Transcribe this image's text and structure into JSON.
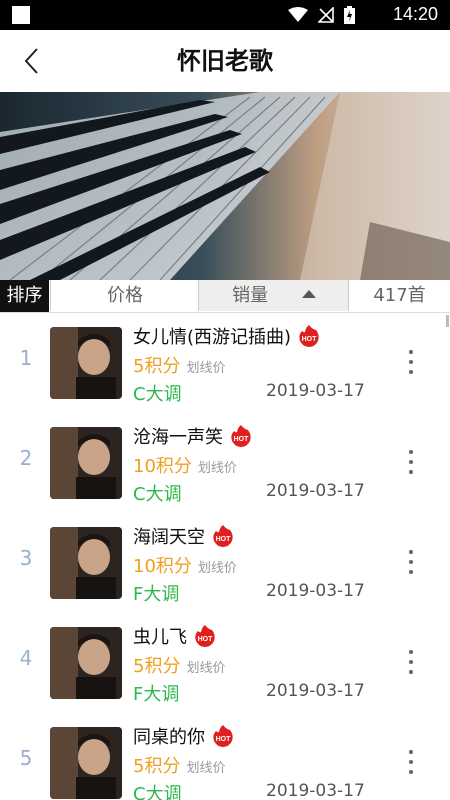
{
  "status_bar": {
    "time": "14:20"
  },
  "header": {
    "title": "怀旧老歌"
  },
  "sort_bar": {
    "label": "排序",
    "options": [
      {
        "label": "价格"
      },
      {
        "label": "销量"
      },
      {
        "label": "417首"
      }
    ]
  },
  "songs": [
    {
      "index": "1",
      "title": "女儿情(西游记插曲)",
      "price": "5积分",
      "strike_label": "划线价",
      "key": "C大调",
      "date": "2019-03-17",
      "hot": "HOT"
    },
    {
      "index": "2",
      "title": "沧海一声笑",
      "price": "10积分",
      "strike_label": "划线价",
      "key": "C大调",
      "date": "2019-03-17",
      "hot": "HOT"
    },
    {
      "index": "3",
      "title": "海阔天空",
      "price": "10积分",
      "strike_label": "划线价",
      "key": "F大调",
      "date": "2019-03-17",
      "hot": "HOT"
    },
    {
      "index": "4",
      "title": "虫儿飞",
      "price": "5积分",
      "strike_label": "划线价",
      "key": "F大调",
      "date": "2019-03-17",
      "hot": "HOT"
    },
    {
      "index": "5",
      "title": "同桌的你",
      "price": "5积分",
      "strike_label": "划线价",
      "key": "C大调",
      "date": "2019-03-17",
      "hot": "HOT"
    }
  ],
  "colors": {
    "price": "#f0a020",
    "key": "#2db84a",
    "index": "#9bb0cc",
    "hot_badge": "#e0201e"
  }
}
